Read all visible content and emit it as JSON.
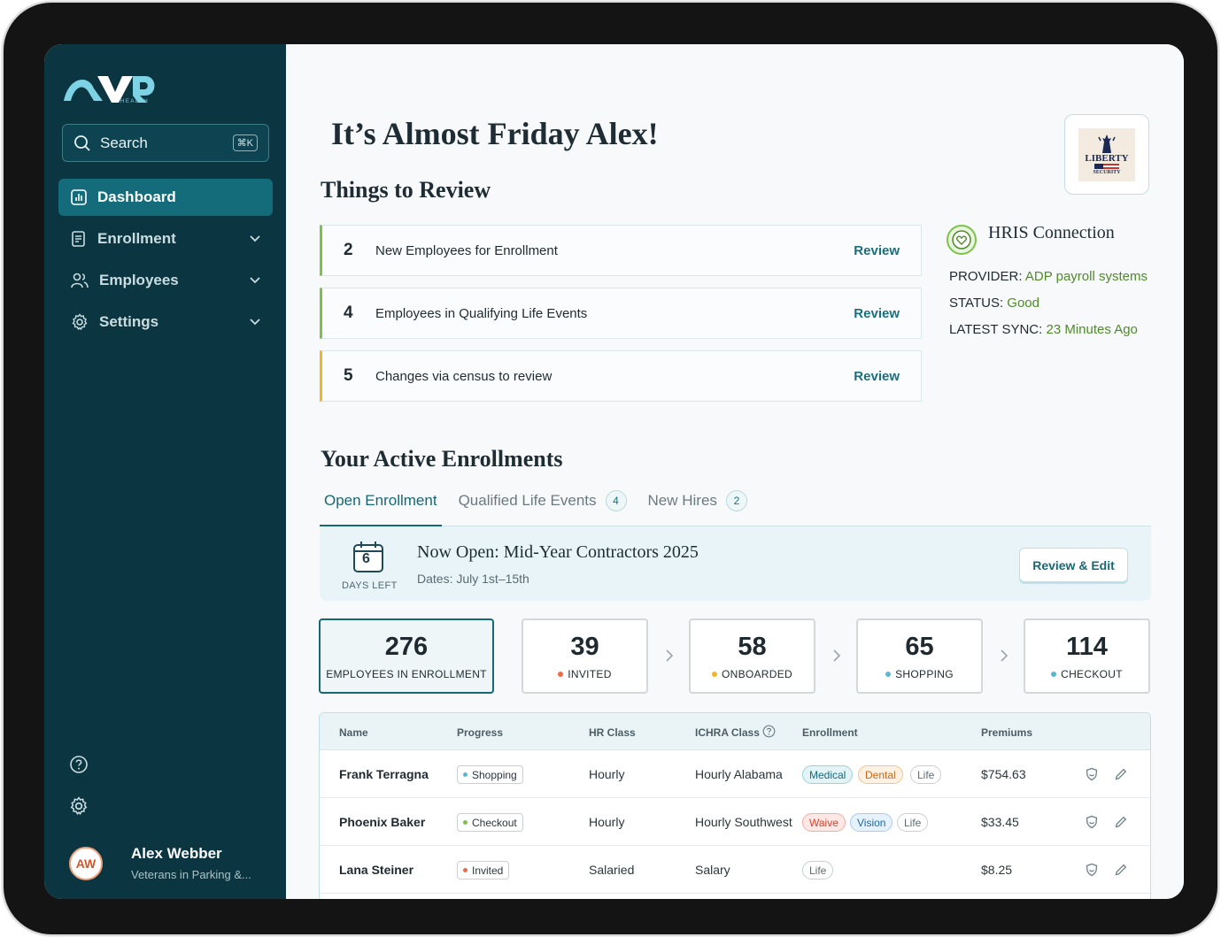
{
  "app": {
    "logo_sub": "HEALTH",
    "search": {
      "label": "Search",
      "shortcut": "⌘K"
    },
    "nav": [
      {
        "label": "Dashboard",
        "icon": "chart-icon",
        "active": true
      },
      {
        "label": "Enrollment",
        "icon": "clipboard-icon"
      },
      {
        "label": "Employees",
        "icon": "users-icon"
      },
      {
        "label": "Settings",
        "icon": "gear-icon"
      }
    ],
    "user": {
      "initials": "AW",
      "name": "Alex Webber",
      "org": "Veterans in Parking &..."
    }
  },
  "header": {
    "greeting": "It’s Almost Friday Alex!"
  },
  "brand": {
    "word": "LIBERTY",
    "sub": "SECURITY"
  },
  "review": {
    "title": "Things to Review",
    "items": [
      {
        "count": "2",
        "label": "New Employees for Enrollment",
        "action": "Review",
        "status_color": "#7cc249"
      },
      {
        "count": "4",
        "label": "Employees in Qualifying Life Events",
        "action": "Review",
        "status_color": "#7cc249"
      },
      {
        "count": "5",
        "label": "Changes via census to review",
        "action": "Review",
        "status_color": "#f2b42a"
      }
    ]
  },
  "hris": {
    "title": "HRIS Connection",
    "provider_label": "PROVIDER:",
    "provider_value": "ADP payroll systems",
    "status_label": "STATUS:",
    "status_value": "Good",
    "sync_label": "LATEST SYNC:",
    "sync_value": "23 Minutes Ago"
  },
  "enrollments": {
    "title": "Your Active Enrollments",
    "tabs": [
      {
        "label": "Open Enrollment",
        "count": "",
        "active": true
      },
      {
        "label": "Qualified Life Events",
        "count": "4"
      },
      {
        "label": "New Hires",
        "count": "2"
      }
    ],
    "banner": {
      "days": "6",
      "days_label": "DAYS LEFT",
      "title": "Now Open: Mid-Year Contractors 2025",
      "dates": "Dates: July 1st–15th",
      "button": "Review & Edit"
    },
    "stats": [
      {
        "value": "276",
        "label": "EMPLOYEES IN ENROLLMENT",
        "dot": ""
      },
      {
        "value": "39",
        "label": "INVITED",
        "dot": "#f06a4a"
      },
      {
        "value": "58",
        "label": "ONBOARDED",
        "dot": "#f2b42a"
      },
      {
        "value": "65",
        "label": "SHOPPING",
        "dot": "#5bb7d0"
      },
      {
        "value": "114",
        "label": "CHECKOUT",
        "dot": "#5bb7d0"
      }
    ],
    "table": {
      "headers": [
        "Name",
        "Progress",
        "HR Class",
        "ICHRA Class",
        "Enrollment",
        "Premiums"
      ],
      "rows": [
        {
          "name": "Frank  Terragna",
          "progress": "Shopping",
          "progress_dot": "#5bb7d0",
          "hr_class": "Hourly",
          "ichra": "Hourly Alabama",
          "tags": [
            "Medical",
            "Dental",
            "Life"
          ],
          "premium": "$754.63"
        },
        {
          "name": "Phoenix Baker",
          "progress": "Checkout",
          "progress_dot": "#7cc249",
          "hr_class": "Hourly",
          "ichra": "Hourly Southwest",
          "tags": [
            "Waive",
            "Vision",
            "Life"
          ],
          "premium": "$33.45"
        },
        {
          "name": "Lana Steiner",
          "progress": "Invited",
          "progress_dot": "#f06a4a",
          "hr_class": "Salaried",
          "ichra": "Salary",
          "tags": [
            "Life"
          ],
          "premium": "$8.25"
        }
      ]
    }
  }
}
